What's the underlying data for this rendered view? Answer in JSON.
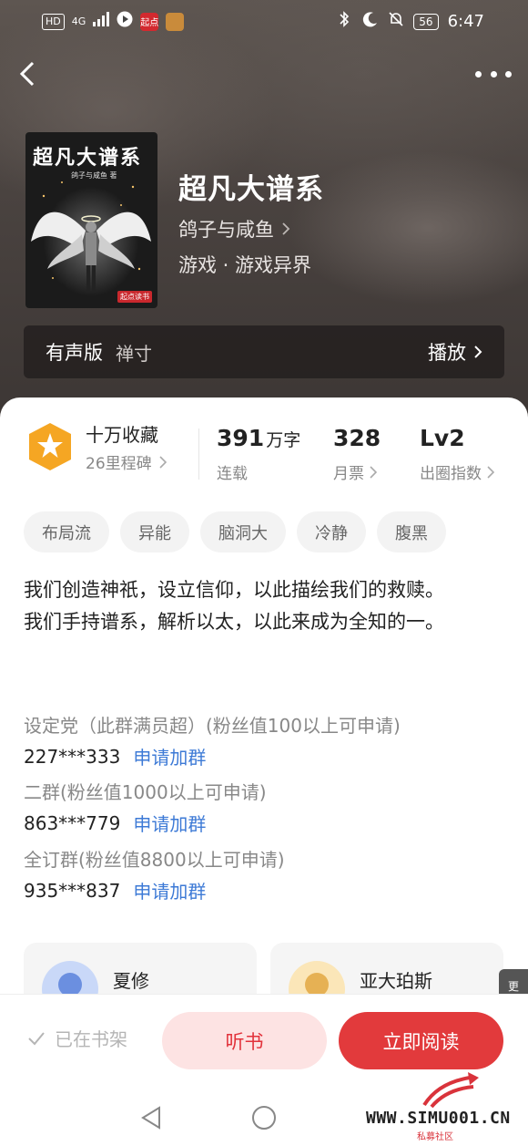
{
  "status_bar": {
    "hd": "HD",
    "net": "4G",
    "app_badge": "起点",
    "battery": "56",
    "time": "6:47"
  },
  "book": {
    "cover_title": "超凡大谱系",
    "cover_author": "鸽子与咸鱼 著",
    "cover_publisher": "起点读书",
    "title": "超凡大谱系",
    "author": "鸽子与咸鱼",
    "genre": "游戏 · 游戏异界"
  },
  "audio": {
    "label": "有声版",
    "narrator": "禅寸",
    "play": "播放"
  },
  "honor": {
    "title": "十万收藏",
    "subtitle": "26里程碑"
  },
  "stats": [
    {
      "value": "391",
      "unit": "万字",
      "label": "连载"
    },
    {
      "value": "328",
      "unit": "",
      "label": "月票"
    },
    {
      "value": "Lv2",
      "unit": "",
      "label": "出圈指数"
    }
  ],
  "tags": [
    "布局流",
    "异能",
    "脑洞大",
    "冷静",
    "腹黑"
  ],
  "description": {
    "line1": "我们创造神祇，设立信仰，以此描绘我们的救赎。",
    "line2": "我们手持谱系，解析以太，以此来成为全知的一。"
  },
  "groups": [
    {
      "name": "设定党（此群满员超）(粉丝值100以上可申请)",
      "number": "227***333",
      "action": "申请加群"
    },
    {
      "name": "二群(粉丝值1000以上可申请)",
      "number": "863***779",
      "action": "申请加群"
    },
    {
      "name": "全订群(粉丝值8800以上可申请)",
      "number": "935***837",
      "action": "申请加群"
    }
  ],
  "characters": [
    {
      "name": "夏修"
    },
    {
      "name": "亚大珀斯"
    }
  ],
  "more_tab": "更",
  "bottom": {
    "shelf": "已在书架",
    "listen": "听书",
    "read": "立即阅读"
  },
  "watermark": {
    "text": "WWW.SIMU001.CN",
    "sub": "私募社区"
  },
  "colors": {
    "accent": "#e23a3c",
    "link": "#3d7ad6",
    "medal": "#f5a623"
  }
}
